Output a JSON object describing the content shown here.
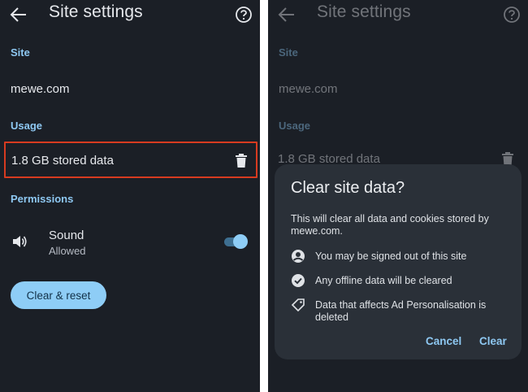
{
  "left": {
    "title": "Site settings",
    "site_label": "Site",
    "site_value": "mewe.com",
    "usage_label": "Usage",
    "usage_value": "1.8 GB stored data",
    "permissions_label": "Permissions",
    "sound_title": "Sound",
    "sound_status": "Allowed",
    "sound_enabled": true,
    "clear_reset_label": "Clear & reset",
    "highlight_color": "#d73b20"
  },
  "right": {
    "title": "Site settings",
    "site_label": "Site",
    "site_value": "mewe.com",
    "usage_label": "Usage",
    "usage_value": "1.8 GB stored data",
    "dialog": {
      "title": "Clear site data?",
      "description": "This will clear all data and cookies stored by mewe.com.",
      "items": [
        {
          "icon": "account-circle-icon",
          "text": "You may be signed out of this site"
        },
        {
          "icon": "check-circle-icon",
          "text": "Any offline data will be cleared"
        },
        {
          "icon": "tag-icon",
          "text": "Data that affects Ad Personalisation is deleted"
        }
      ],
      "cancel_label": "Cancel",
      "clear_label": "Clear"
    }
  },
  "colors": {
    "background": "#1b1f26",
    "dialog": "#2a3038",
    "accent": "#8ecdf6",
    "section_label": "#8ec8f2"
  }
}
